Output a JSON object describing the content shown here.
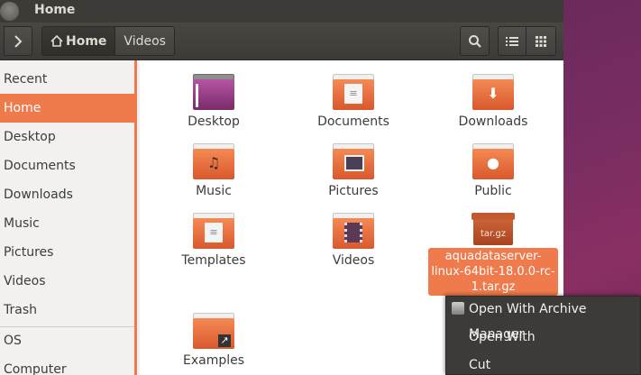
{
  "window": {
    "title": "Home"
  },
  "toolbar": {
    "breadcrumbs": [
      {
        "label": "Home",
        "icon": "home-icon"
      },
      {
        "label": "Videos"
      }
    ],
    "forward_icon": "chevron-right-icon",
    "search_icon": "search-icon",
    "list_view_icon": "list-view-icon",
    "grid_view_icon": "grid-view-icon"
  },
  "sidebar": {
    "items": [
      {
        "label": "Recent"
      },
      {
        "label": "Home",
        "active": true
      },
      {
        "label": "Desktop"
      },
      {
        "label": "Documents"
      },
      {
        "label": "Downloads"
      },
      {
        "label": "Music"
      },
      {
        "label": "Pictures"
      },
      {
        "label": "Videos"
      },
      {
        "label": "Trash"
      },
      {
        "label": "OS"
      },
      {
        "label": "Computer"
      }
    ]
  },
  "files": [
    {
      "label": "Desktop",
      "icon": "desktop-folder-icon"
    },
    {
      "label": "Documents",
      "icon": "documents-folder-icon"
    },
    {
      "label": "Downloads",
      "icon": "downloads-folder-icon"
    },
    {
      "label": "Music",
      "icon": "music-folder-icon"
    },
    {
      "label": "Pictures",
      "icon": "pictures-folder-icon"
    },
    {
      "label": "Public",
      "icon": "public-folder-icon"
    },
    {
      "label": "Templates",
      "icon": "templates-folder-icon"
    },
    {
      "label": "Videos",
      "icon": "videos-folder-icon"
    },
    {
      "label_lines": [
        "aquadataserver-",
        "linux-64bit-18.0.0-rc-",
        "1.tar.gz"
      ],
      "icon": "archive-icon",
      "badge": "tar.gz",
      "selected": true
    },
    {
      "label": "Examples",
      "icon": "examples-folder-icon"
    }
  ],
  "context_menu": {
    "items": [
      {
        "label": "Open With Archive Manager",
        "icon": "archive-manager-icon"
      },
      {
        "label": "Open With"
      },
      {
        "label": "Cut"
      }
    ]
  },
  "colors": {
    "accent": "#ef7a4b",
    "titlebar": "#3c3b37",
    "desktop": "#77216f"
  }
}
